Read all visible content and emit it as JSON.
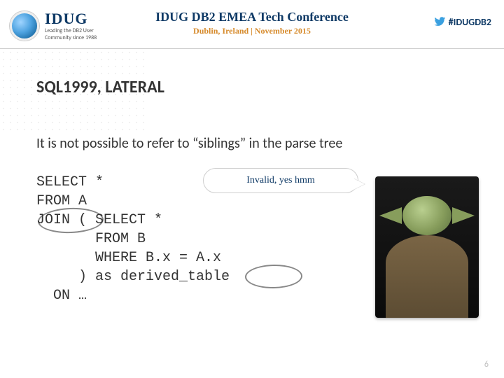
{
  "header": {
    "logo_main": "IDUG",
    "logo_sub1": "Leading the DB2 User",
    "logo_sub2": "Community since 1988",
    "conf_title": "IDUG DB2 EMEA Tech Conference",
    "conf_sub": "Dublin, Ireland  |  November 2015",
    "hashtag": "#IDUGDB2"
  },
  "slide": {
    "title": "SQL1999, LATERAL",
    "body": "It is not possible to refer to “siblings” in the parse tree",
    "bubble": "Invalid, yes hmm",
    "code": {
      "l1": "SELECT *",
      "l2": "FROM A",
      "l3": "JOIN ( SELECT *",
      "l4": "       FROM B",
      "l5": "       WHERE B.x = A.x",
      "l6": "     ) as derived_table",
      "l7": "  ON …"
    },
    "page_number": "6"
  }
}
